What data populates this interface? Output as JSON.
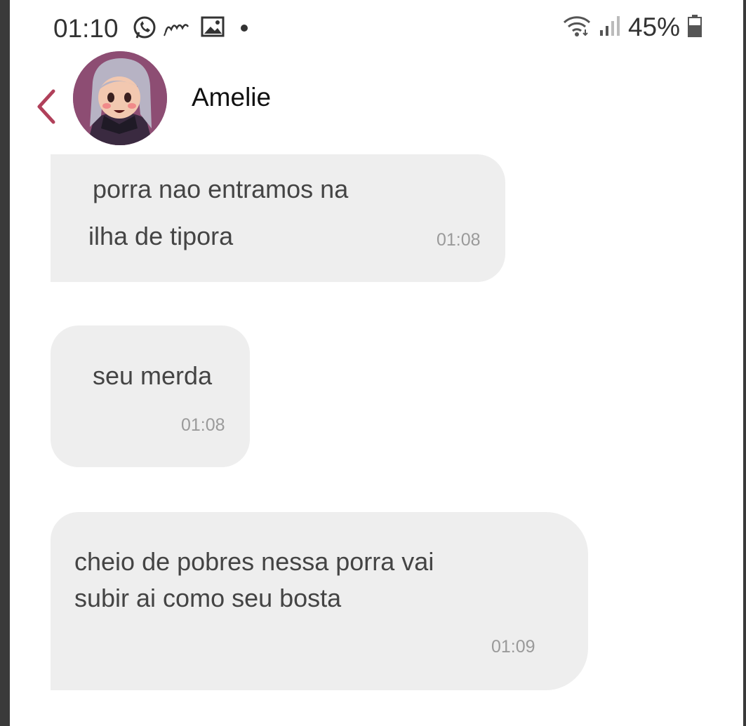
{
  "status_bar": {
    "time": "01:10",
    "battery": "45%",
    "icons": [
      "whatsapp-icon",
      "notification-icon",
      "gallery-icon",
      "dot-icon",
      "wifi-icon",
      "signal-icon",
      "battery-icon"
    ]
  },
  "header": {
    "contact_name": "Amelie",
    "icons": [
      "back-chevron-icon",
      "avatar"
    ]
  },
  "messages": [
    {
      "lines": [
        "porra nao entramos na",
        "ilha de tipora"
      ],
      "time": "01:08"
    },
    {
      "lines": [
        "seu merda"
      ],
      "time": "01:08"
    },
    {
      "lines": [
        "cheio de pobres nessa porra vai",
        "subir ai como seu bosta"
      ],
      "time": "01:09"
    }
  ],
  "colors": {
    "bubble": "#eeeeee",
    "back_chevron": "#b0405a",
    "frame": "#3a3a3a",
    "avatar_bg": "#8d4d73"
  }
}
